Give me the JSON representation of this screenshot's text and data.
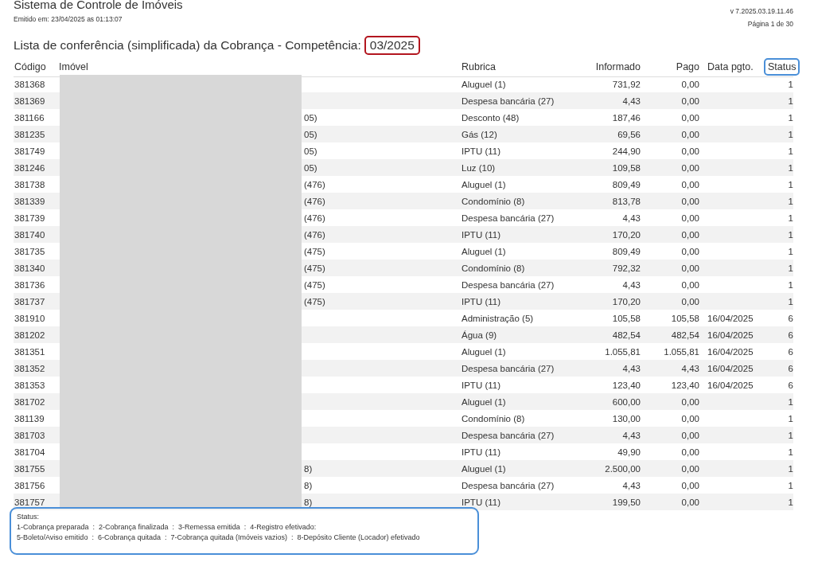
{
  "header": {
    "title": "Sistema de Controle de Imóveis",
    "emitted": "Emitido em: 23/04/2025 as 01:13:07",
    "version": "v 7.2025.03.19.11.46",
    "page": "Página 1 de 30"
  },
  "report": {
    "heading": "Lista de conferência (simplificada) da Cobrança - Competência:",
    "competencia": "03/2025"
  },
  "table": {
    "imovel_redacted": true,
    "columns": [
      "Código",
      "Imóvel",
      "Rubrica",
      "Informado",
      "Pago",
      "Data pgto.",
      "Status"
    ],
    "rows": [
      {
        "codigo": "381368",
        "rubrica": "Aluguel (1)",
        "informado": "731,92",
        "pago": "0,00",
        "status": "1"
      },
      {
        "codigo": "381369",
        "rubrica": "Despesa bancária (27)",
        "informado": "4,43",
        "pago": "0,00",
        "status": "1"
      },
      {
        "codigo": "381166",
        "imovel_end": "05)",
        "rubrica": "Desconto (48)",
        "informado": "187,46",
        "pago": "0,00",
        "status": "1"
      },
      {
        "codigo": "381235",
        "imovel_end": "05)",
        "rubrica": "Gás (12)",
        "informado": "69,56",
        "pago": "0,00",
        "status": "1"
      },
      {
        "codigo": "381749",
        "imovel_end": "05)",
        "rubrica": "IPTU (11)",
        "informado": "244,90",
        "pago": "0,00",
        "status": "1"
      },
      {
        "codigo": "381246",
        "imovel_end": "05)",
        "rubrica": "Luz (10)",
        "informado": "109,58",
        "pago": "0,00",
        "status": "1"
      },
      {
        "codigo": "381738",
        "imovel_end": "(476)",
        "rubrica": "Aluguel (1)",
        "informado": "809,49",
        "pago": "0,00",
        "status": "1"
      },
      {
        "codigo": "381339",
        "imovel_end": "(476)",
        "rubrica": "Condomínio (8)",
        "informado": "813,78",
        "pago": "0,00",
        "status": "1"
      },
      {
        "codigo": "381739",
        "imovel_end": "(476)",
        "rubrica": "Despesa bancária (27)",
        "informado": "4,43",
        "pago": "0,00",
        "status": "1"
      },
      {
        "codigo": "381740",
        "imovel_end": "(476)",
        "rubrica": "IPTU (11)",
        "informado": "170,20",
        "pago": "0,00",
        "status": "1"
      },
      {
        "codigo": "381735",
        "imovel_end": "(475)",
        "rubrica": "Aluguel (1)",
        "informado": "809,49",
        "pago": "0,00",
        "status": "1"
      },
      {
        "codigo": "381340",
        "imovel_end": "(475)",
        "rubrica": "Condomínio (8)",
        "informado": "792,32",
        "pago": "0,00",
        "status": "1"
      },
      {
        "codigo": "381736",
        "imovel_end": "(475)",
        "rubrica": "Despesa bancária (27)",
        "informado": "4,43",
        "pago": "0,00",
        "status": "1"
      },
      {
        "codigo": "381737",
        "imovel_end": "(475)",
        "rubrica": "IPTU (11)",
        "informado": "170,20",
        "pago": "0,00",
        "status": "1"
      },
      {
        "codigo": "381910",
        "rubrica": "Administração (5)",
        "informado": "105,58",
        "pago": "105,58",
        "data": "16/04/2025",
        "status": "6"
      },
      {
        "codigo": "381202",
        "rubrica": "Água (9)",
        "informado": "482,54",
        "pago": "482,54",
        "data": "16/04/2025",
        "status": "6"
      },
      {
        "codigo": "381351",
        "rubrica": "Aluguel (1)",
        "informado": "1.055,81",
        "pago": "1.055,81",
        "data": "16/04/2025",
        "status": "6"
      },
      {
        "codigo": "381352",
        "rubrica": "Despesa bancária (27)",
        "informado": "4,43",
        "pago": "4,43",
        "data": "16/04/2025",
        "status": "6"
      },
      {
        "codigo": "381353",
        "rubrica": "IPTU (11)",
        "informado": "123,40",
        "pago": "123,40",
        "data": "16/04/2025",
        "status": "6"
      },
      {
        "codigo": "381702",
        "rubrica": "Aluguel (1)",
        "informado": "600,00",
        "pago": "0,00",
        "status": "1"
      },
      {
        "codigo": "381139",
        "rubrica": "Condomínio (8)",
        "informado": "130,00",
        "pago": "0,00",
        "status": "1"
      },
      {
        "codigo": "381703",
        "rubrica": "Despesa bancária (27)",
        "informado": "4,43",
        "pago": "0,00",
        "status": "1"
      },
      {
        "codigo": "381704",
        "rubrica": "IPTU (11)",
        "informado": "49,90",
        "pago": "0,00",
        "status": "1"
      },
      {
        "codigo": "381755",
        "imovel_end": "8)",
        "rubrica": "Aluguel (1)",
        "informado": "2.500,00",
        "pago": "0,00",
        "status": "1"
      },
      {
        "codigo": "381756",
        "imovel_end": "8)",
        "rubrica": "Despesa bancária (27)",
        "informado": "4,43",
        "pago": "0,00",
        "status": "1"
      },
      {
        "codigo": "381757",
        "imovel_end": "8)",
        "rubrica": "IPTU (11)",
        "informado": "199,50",
        "pago": "0,00",
        "status": "1"
      }
    ]
  },
  "legend": {
    "title": "Status:",
    "lines": [
      "1-Cobrança preparada  :  2-Cobrança finalizada  :  3-Remessa emitida  :  4-Registro efetivado:",
      "5-Boleto/Aviso emitido  :  6-Cobrança quitada  :  7-Cobrança quitada (Imóveis vazios)  :  8-Depósito Cliente (Locador) efetivado"
    ]
  }
}
